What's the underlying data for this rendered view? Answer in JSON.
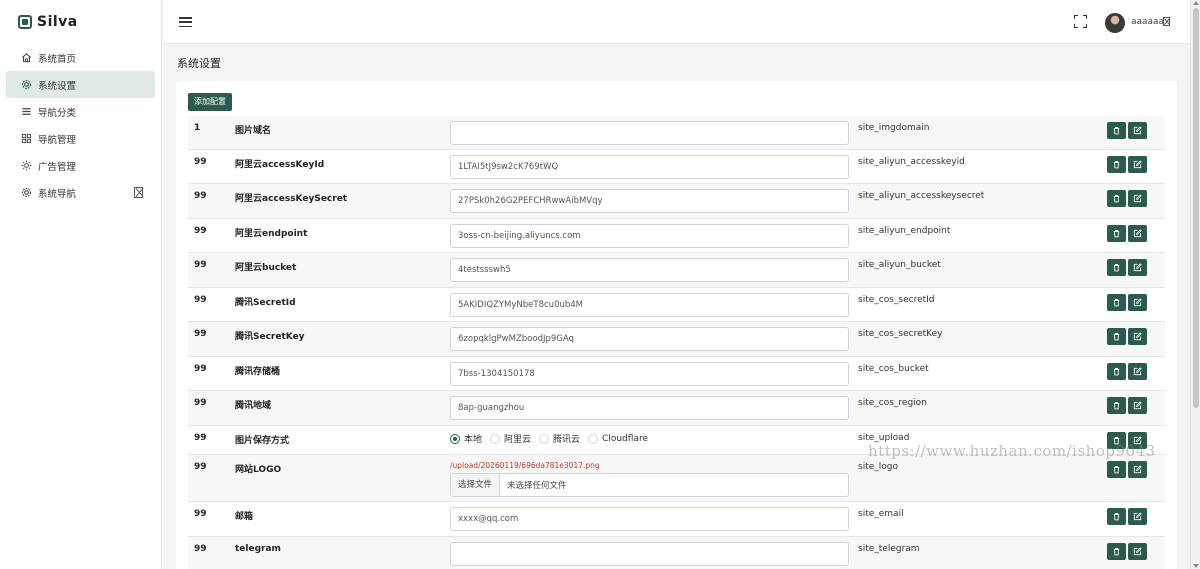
{
  "brand": {
    "name": "Silva"
  },
  "sidebar": {
    "items": [
      {
        "label": "系统首页",
        "icon": "home-icon"
      },
      {
        "label": "系统设置",
        "icon": "gear-icon",
        "active": true
      },
      {
        "label": "导航分类",
        "icon": "list-icon"
      },
      {
        "label": "导航管理",
        "icon": "grid-icon"
      },
      {
        "label": "广告管理",
        "icon": "sun-icon"
      },
      {
        "label": "系统导航",
        "icon": "settings-icon",
        "has_submenu": true
      }
    ]
  },
  "topbar": {
    "username": "aaaaaa"
  },
  "page": {
    "title": "系统设置",
    "add_button": "添加配置"
  },
  "colors": {
    "accent": "#2b5b4e",
    "active_bg": "#dfe8e5",
    "error_text": "#c0392b"
  },
  "config_rows": [
    {
      "sort": "1",
      "name": "图片域名",
      "type": "text",
      "value": "",
      "key": "site_imgdomain"
    },
    {
      "sort": "99",
      "name": "阿里云accessKeyId",
      "type": "text",
      "value": "1LTAI5tJ9sw2cK769tWQ",
      "key": "site_aliyun_accesskeyid"
    },
    {
      "sort": "99",
      "name": "阿里云accessKeySecret",
      "type": "text",
      "value": "27PSk0h26G2PEFCHRwwAibMVqy",
      "key": "site_aliyun_accesskeysecret"
    },
    {
      "sort": "99",
      "name": "阿里云endpoint",
      "type": "text",
      "value": "3oss-cn-beijing.aliyuncs.com",
      "key": "site_aliyun_endpoint"
    },
    {
      "sort": "99",
      "name": "阿里云bucket",
      "type": "text",
      "value": "4testssswh5",
      "key": "site_aliyun_bucket"
    },
    {
      "sort": "99",
      "name": "腾讯SecretId",
      "type": "text",
      "value": "5AKIDIQZYMyNbeT8cu0ub4M",
      "key": "site_cos_secretId"
    },
    {
      "sort": "99",
      "name": "腾讯SecretKey",
      "type": "text",
      "value": "6zopqklgPwMZboodJp9GAq",
      "key": "site_cos_secretKey"
    },
    {
      "sort": "99",
      "name": "腾讯存储桶",
      "type": "text",
      "value": "7bss-1304150178",
      "key": "site_cos_bucket"
    },
    {
      "sort": "99",
      "name": "腾讯地域",
      "type": "text",
      "value": "8ap-guangzhou",
      "key": "site_cos_region"
    },
    {
      "sort": "99",
      "name": "图片保存方式",
      "type": "radio",
      "options": [
        "本地",
        "阿里云",
        "腾讯云",
        "Cloudflare"
      ],
      "selected": "本地",
      "key": "site_upload"
    },
    {
      "sort": "99",
      "name": "网站LOGO",
      "type": "file",
      "current_path": "/upload/20260119/696da781e3017.png",
      "file_button": "选择文件",
      "file_status": "未选择任何文件",
      "key": "site_logo"
    },
    {
      "sort": "99",
      "name": "邮箱",
      "type": "text",
      "value": "xxxx@qq.com",
      "key": "site_email"
    },
    {
      "sort": "99",
      "name": "telegram",
      "type": "text",
      "value": "",
      "key": "site_telegram"
    }
  ],
  "watermark": "https://www.huzhan.com/ishop9043"
}
